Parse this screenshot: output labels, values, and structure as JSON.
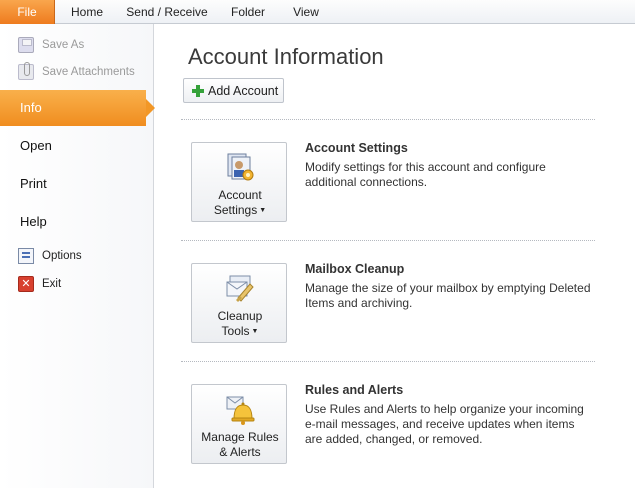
{
  "ribbon": {
    "tabs": [
      {
        "label": "File"
      },
      {
        "label": "Home"
      },
      {
        "label": "Send / Receive"
      },
      {
        "label": "Folder"
      },
      {
        "label": "View"
      }
    ]
  },
  "nav": {
    "commands_top": [
      {
        "label": "Save As",
        "icon": "save-icon"
      },
      {
        "label": "Save Attachments",
        "icon": "attachment-icon"
      }
    ],
    "items": [
      {
        "label": "Info"
      },
      {
        "label": "Open"
      },
      {
        "label": "Print"
      },
      {
        "label": "Help"
      }
    ],
    "commands_bottom": [
      {
        "label": "Options",
        "icon": "options-icon"
      },
      {
        "label": "Exit",
        "icon": "exit-icon"
      }
    ]
  },
  "main": {
    "title": "Account Information",
    "add_account_label": "Add Account",
    "sections": [
      {
        "button_line1": "Account",
        "button_line2": "Settings",
        "title": "Account Settings",
        "description": "Modify settings for this account and configure additional connections."
      },
      {
        "button_line1": "Cleanup",
        "button_line2": "Tools",
        "title": "Mailbox Cleanup",
        "description": "Manage the size of your mailbox by emptying Deleted Items and archiving."
      },
      {
        "button_line1": "Manage Rules",
        "button_line2": "& Alerts",
        "title": "Rules and Alerts",
        "description": "Use Rules and Alerts to help organize your incoming e-mail messages, and receive updates when items are added, changed, or removed."
      }
    ]
  },
  "colors": {
    "accent_orange": "#f08d1f",
    "add_icon_green": "#35a23a"
  }
}
